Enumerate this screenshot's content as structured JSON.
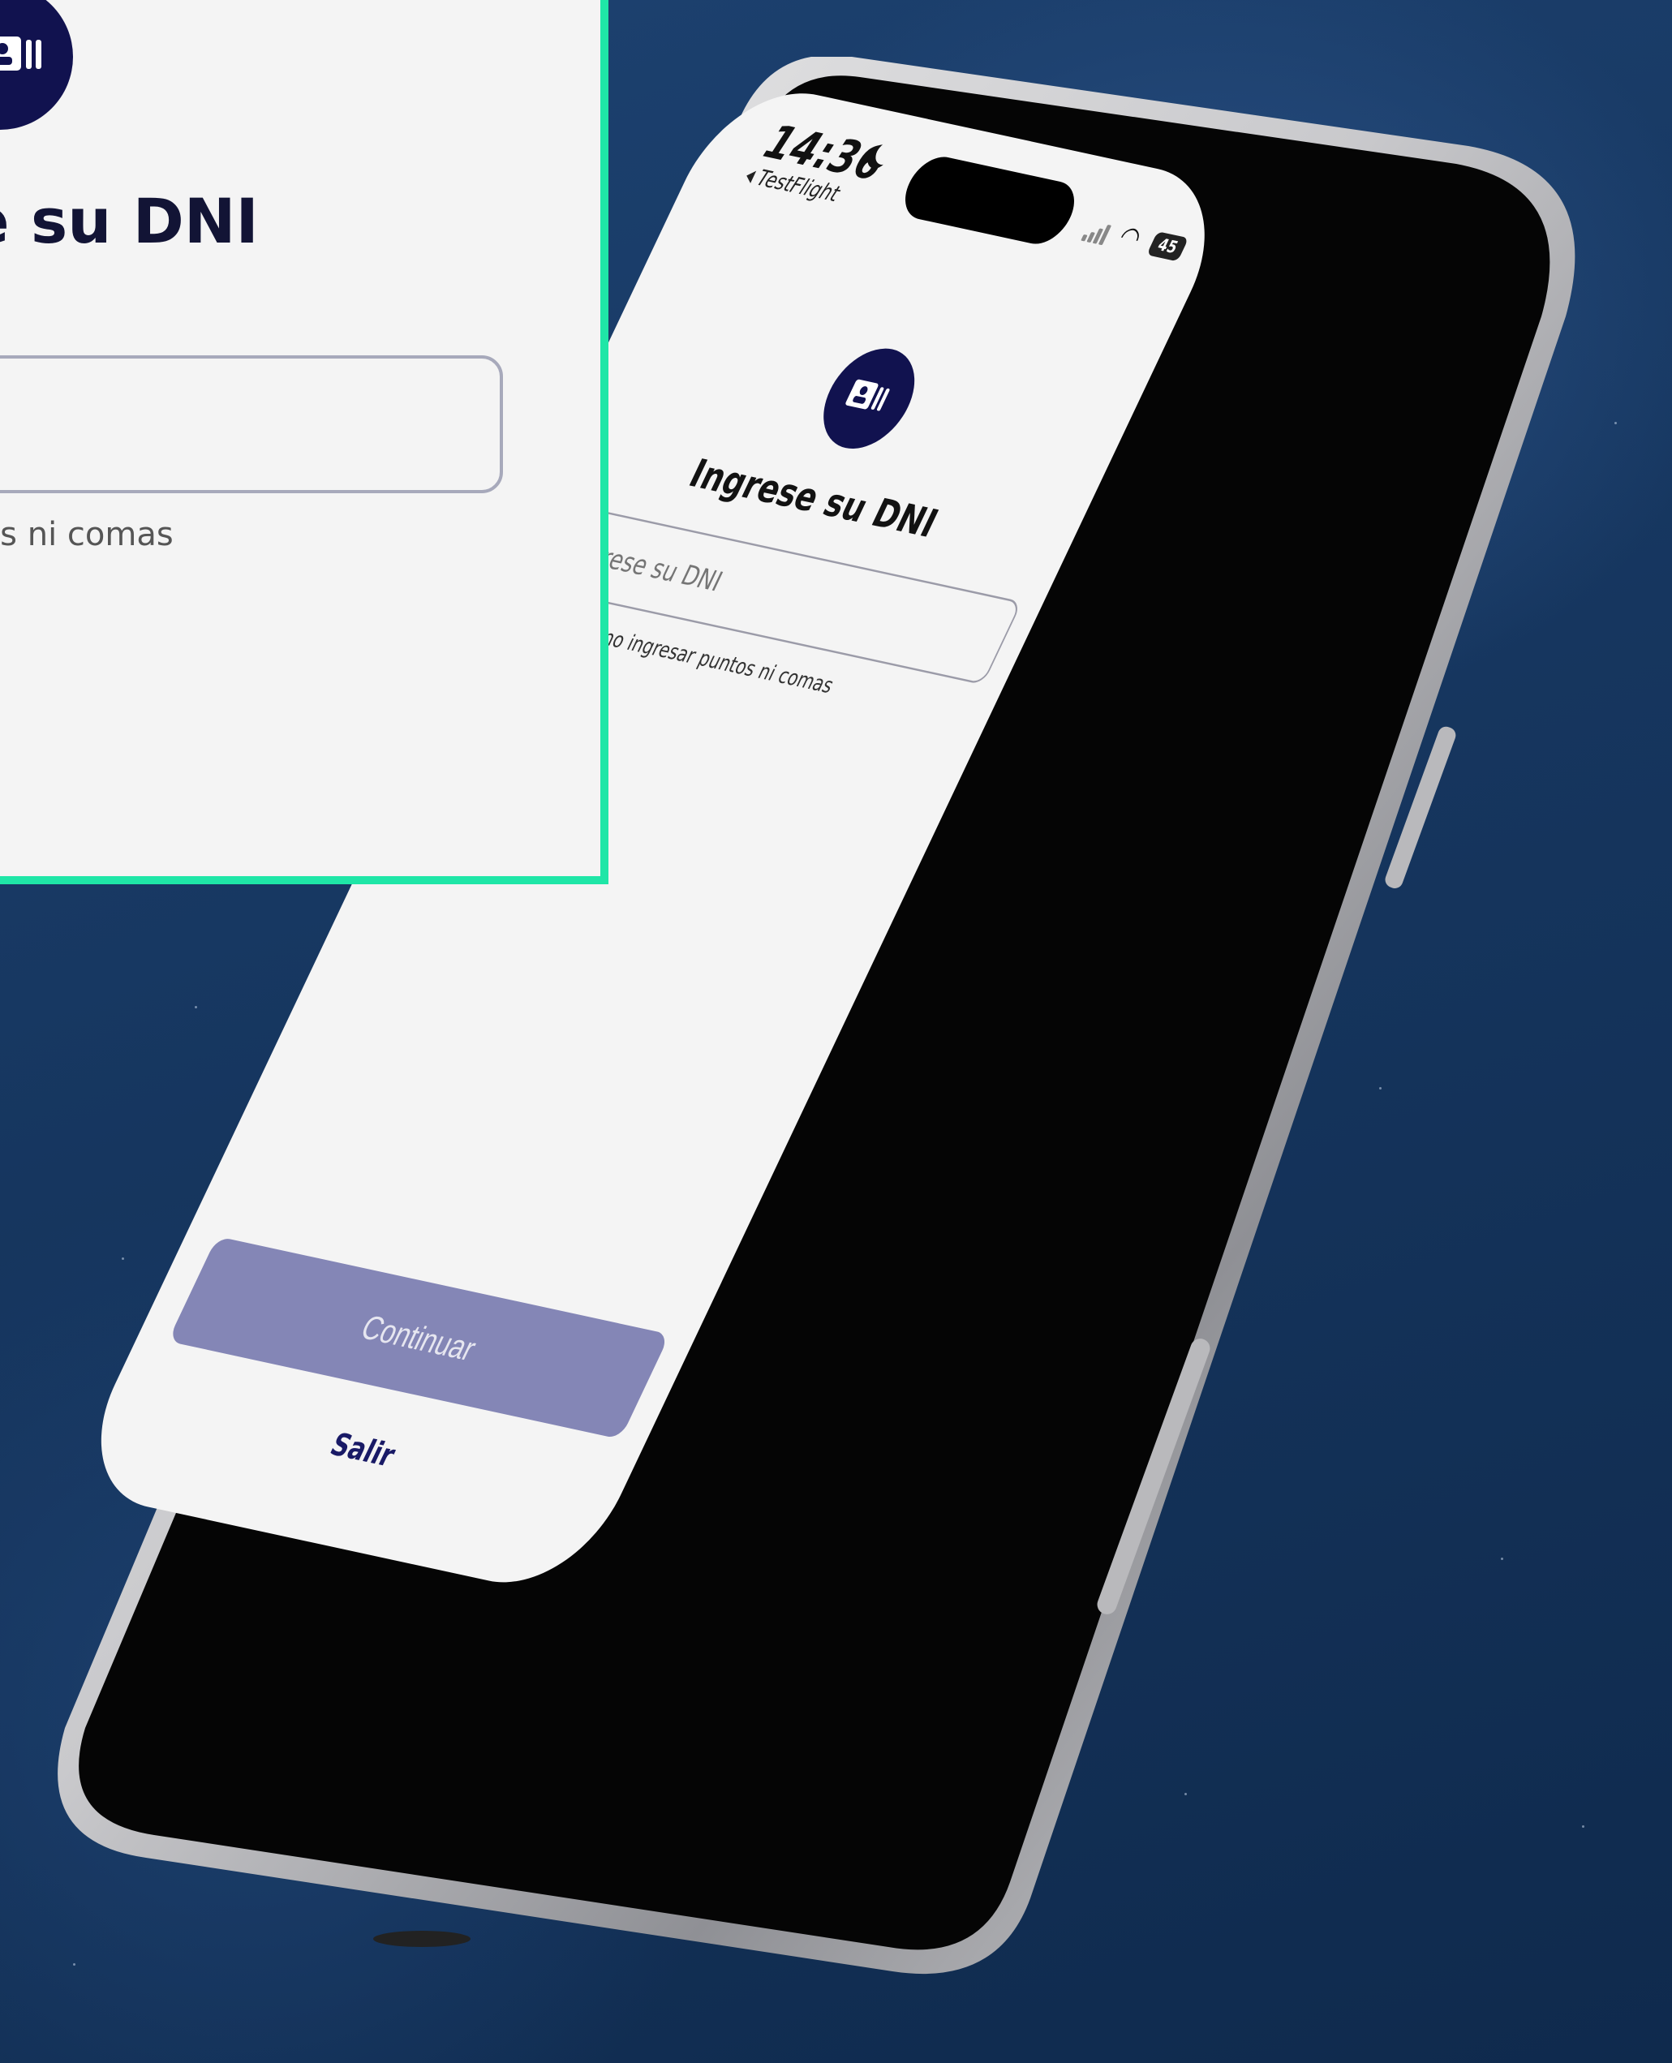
{
  "status_bar": {
    "time": "14:36",
    "back_app": "TestFlight",
    "battery": "45"
  },
  "screen": {
    "title": "Ingrese su DNI",
    "dni_placeholder": "Ingrese su DNI",
    "hint": "Recuerde no ingresar puntos ni comas",
    "continue_label": "Continuar",
    "exit_label": "Salir"
  },
  "zoom_inset": {
    "title_fragment": "e su DNI",
    "hint_fragment": "tos ni comas"
  },
  "colors": {
    "accent_navy": "#11124f",
    "button_disabled": "#8486b6",
    "inset_border": "#1fe6a7",
    "background": "#16365f"
  },
  "icons": [
    "id-card-icon",
    "signal-icon",
    "wifi-icon",
    "battery-icon",
    "back-arrow-icon",
    "moon-icon"
  ]
}
